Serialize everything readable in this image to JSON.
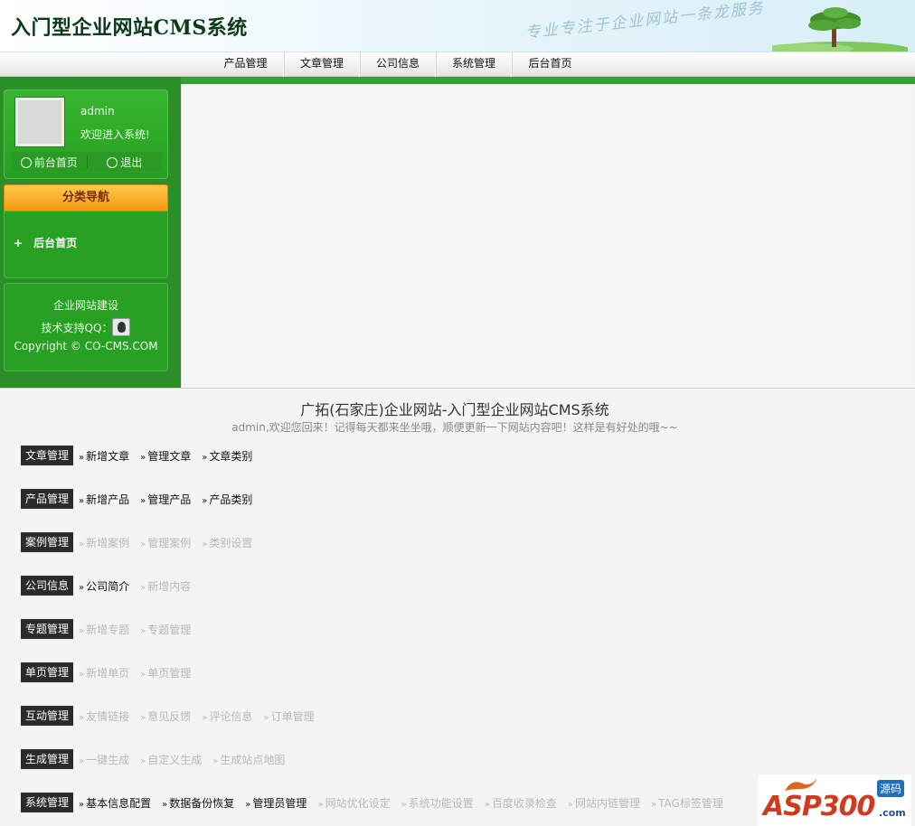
{
  "header": {
    "title": "入门型企业网站CMS系统",
    "slogan": "专业专注于企业网站一条龙服务"
  },
  "nav": {
    "items": [
      "产品管理",
      "文章管理",
      "公司信息",
      "系统管理",
      "后台首页"
    ]
  },
  "sidebar": {
    "user": {
      "name": "admin",
      "welcome": "欢迎进入系统!",
      "front_link": "前台首页",
      "logout": "退出"
    },
    "category": {
      "title": "分类导航",
      "item_plus": "+",
      "item": "后台首页"
    },
    "support": {
      "line1": "企业网站建设",
      "line2": "技术支持QQ：",
      "line3": "Copyright © CO-CMS.COM"
    }
  },
  "content": {
    "title": "广拓(石家庄)企业网站-入门型企业网站CMS系统",
    "subtitle": "admin,欢迎您回来！记得每天都来坐坐哦，顺便更新一下网站内容吧！这样是有好处的哦~~",
    "rows": [
      {
        "label": "文章管理",
        "links": [
          {
            "text": "新增文章",
            "active": true
          },
          {
            "text": "管理文章",
            "active": true
          },
          {
            "text": "文章类别",
            "active": true
          }
        ]
      },
      {
        "label": "产品管理",
        "links": [
          {
            "text": "新增产品",
            "active": true
          },
          {
            "text": "管理产品",
            "active": true
          },
          {
            "text": "产品类别",
            "active": true
          }
        ]
      },
      {
        "label": "案例管理",
        "links": [
          {
            "text": "新增案例",
            "active": false
          },
          {
            "text": "管理案例",
            "active": false
          },
          {
            "text": "类别设置",
            "active": false
          }
        ]
      },
      {
        "label": "公司信息",
        "links": [
          {
            "text": "公司简介",
            "active": true
          },
          {
            "text": "新增内容",
            "active": false
          }
        ]
      },
      {
        "label": "专题管理",
        "links": [
          {
            "text": "新增专题",
            "active": false
          },
          {
            "text": "专题管理",
            "active": false
          }
        ]
      },
      {
        "label": "单页管理",
        "links": [
          {
            "text": "新增单页",
            "active": false
          },
          {
            "text": "单页管理",
            "active": false
          }
        ]
      },
      {
        "label": "互动管理",
        "links": [
          {
            "text": "友情链接",
            "active": false
          },
          {
            "text": "意见反馈",
            "active": false
          },
          {
            "text": "评论信息",
            "active": false
          },
          {
            "text": "订单管理",
            "active": false
          }
        ]
      },
      {
        "label": "生成管理",
        "links": [
          {
            "text": "一键生成",
            "active": false
          },
          {
            "text": "自定义生成",
            "active": false
          },
          {
            "text": "生成站点地图",
            "active": false
          }
        ]
      },
      {
        "label": "系统管理",
        "links": [
          {
            "text": "基本信息配置",
            "active": true
          },
          {
            "text": "数据备份恢复",
            "active": true
          },
          {
            "text": "管理员管理",
            "active": true
          },
          {
            "text": "网站优化设定",
            "active": false
          },
          {
            "text": "系统功能设置",
            "active": false
          },
          {
            "text": "百度收录检查",
            "active": false
          },
          {
            "text": "网站内链管理",
            "active": false
          },
          {
            "text": "TAG标签管理",
            "active": false
          }
        ]
      }
    ]
  },
  "watermark": {
    "logo": "ASP300",
    "tag": "源码",
    "domain": ".com"
  },
  "colors": {
    "sidebar_green": "#2a8f27",
    "category_orange": "#f39a12",
    "label_dark": "#2b2b2b"
  }
}
